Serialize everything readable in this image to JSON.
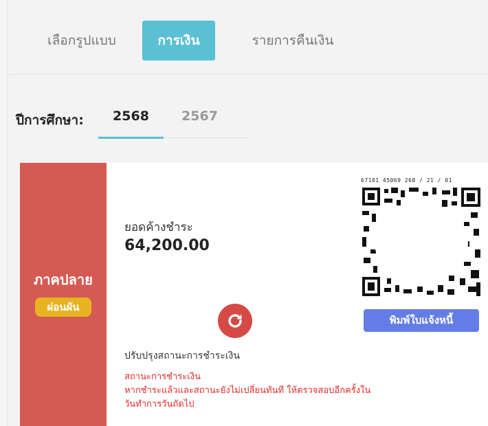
{
  "tabs": [
    {
      "label": "เลือกรูปแบบ",
      "active": false
    },
    {
      "label": "การเงิน",
      "active": true
    },
    {
      "label": "รายการคืนเงิน",
      "active": false
    }
  ],
  "academic_year": {
    "label": "ปีการศึกษา:",
    "years": [
      "2568",
      "2567"
    ],
    "selected": "2568"
  },
  "invoice": {
    "term": "ภาคปลาย",
    "badge": "ผ่อนผัน",
    "due_label": "ยอดค้างชำระ",
    "due_amount": "64,200.00",
    "refresh_label": "ปรับปรุงสถานะการชำระเงิน",
    "status_title": "สถานะการชำระเงิน",
    "status_note_1": "หากชำระแล้วและสถานะยังไม่เปลี่ยนทันที ให้ตรวจสอบอีกครั้งใน",
    "status_note_2": "วันทำการวันถัดไป",
    "qr_caption": "67101 45069 268 / 21 / 01",
    "print_label": "พิมพ์ใบแจ้งหนี้"
  },
  "colors": {
    "accent": "#5bc0d4",
    "term_band": "#d55a53",
    "badge": "#e8b321",
    "refresh": "#d64a46",
    "status_text": "#e32b2b",
    "print_button": "#647de6"
  },
  "icons": {
    "refresh": "refresh-icon",
    "qr": "qr-code-icon"
  }
}
